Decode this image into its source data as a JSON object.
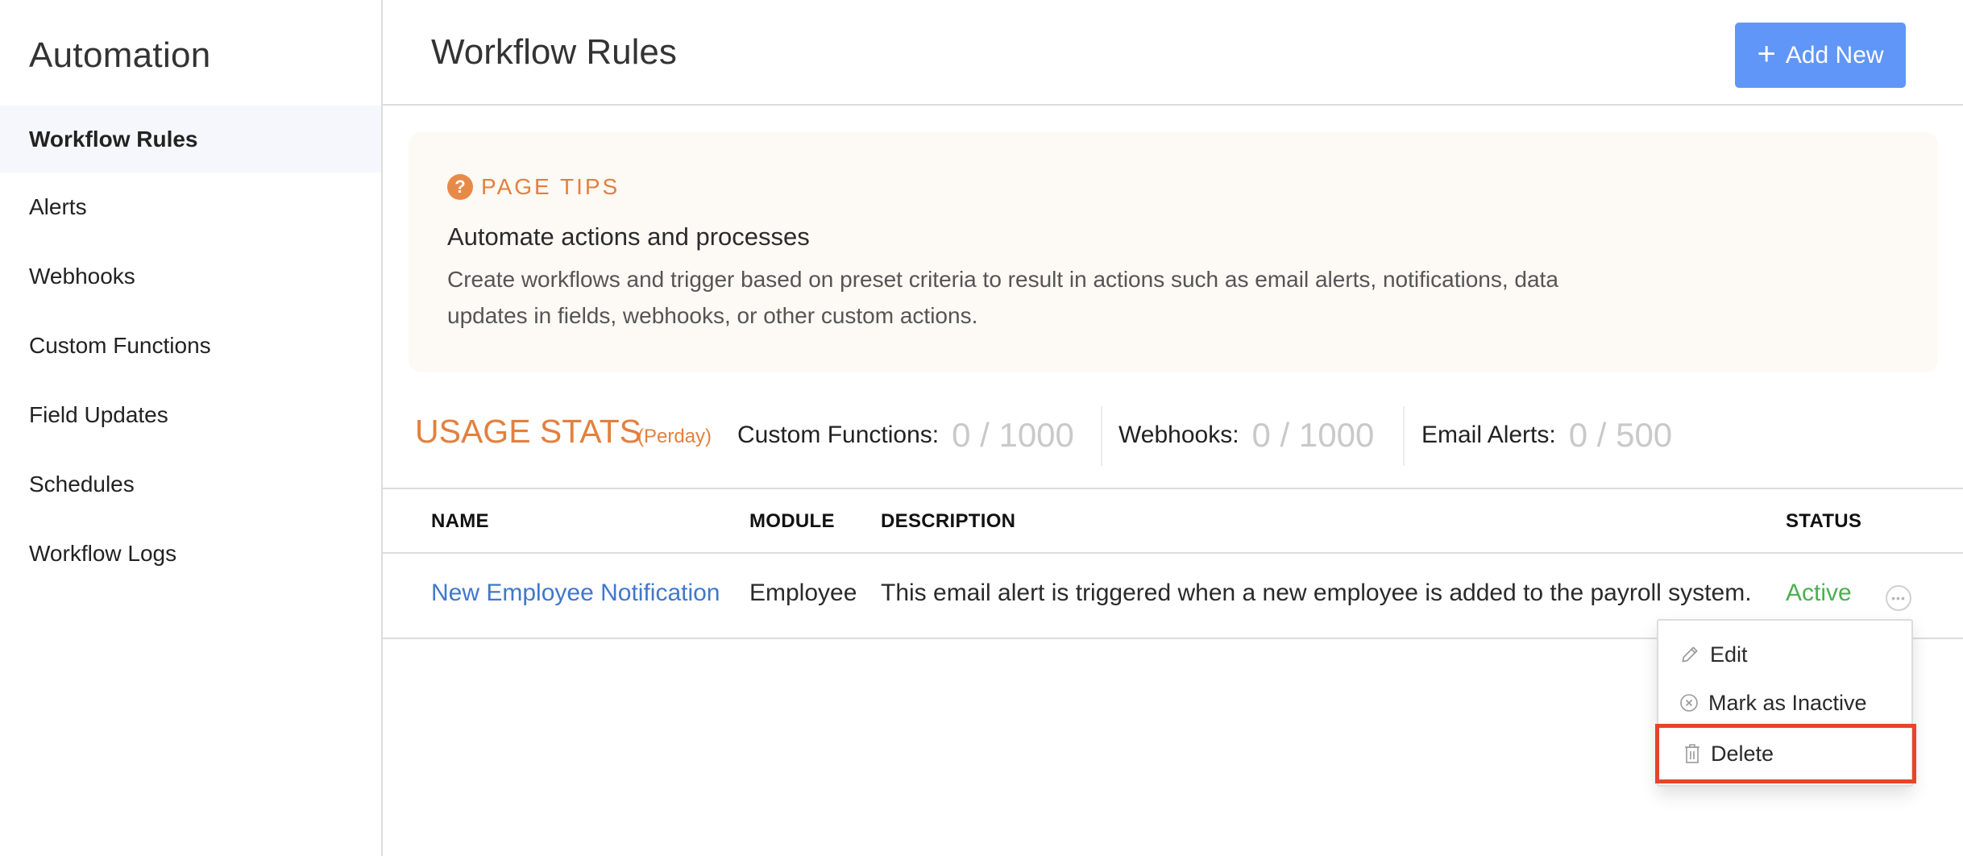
{
  "sidebar": {
    "title": "Automation",
    "items": [
      {
        "label": "Workflow Rules",
        "active": true
      },
      {
        "label": "Alerts"
      },
      {
        "label": "Webhooks"
      },
      {
        "label": "Custom Functions"
      },
      {
        "label": "Field Updates"
      },
      {
        "label": "Schedules"
      },
      {
        "label": "Workflow Logs"
      }
    ]
  },
  "header": {
    "title": "Workflow Rules",
    "add_new_label": "Add New",
    "add_new_icon": "plus-icon"
  },
  "page_tips": {
    "icon": "question-circle-icon",
    "label": "PAGE TIPS",
    "title": "Automate actions and processes",
    "description": "Create workflows and trigger based on preset criteria to result in actions such as email alerts, notifications, data updates in fields, webhooks, or other custom actions."
  },
  "usage_stats": {
    "title": "USAGE STATS",
    "period": "(Perday)",
    "stats": [
      {
        "label": "Custom Functions:",
        "value": "0 / 1000"
      },
      {
        "label": "Webhooks:",
        "value": "0 / 1000"
      },
      {
        "label": "Email Alerts:",
        "value": "0 / 500"
      }
    ]
  },
  "table": {
    "columns": [
      "NAME",
      "MODULE",
      "DESCRIPTION",
      "STATUS"
    ],
    "rows": [
      {
        "name": "New Employee Notification",
        "module": "Employee",
        "description": "This email alert is triggered when a new employee is added to the payroll system.",
        "status": "Active"
      }
    ]
  },
  "row_menu": {
    "items": [
      {
        "label": "Edit",
        "icon": "pencil-icon"
      },
      {
        "label": "Mark as Inactive",
        "icon": "x-circle-icon"
      },
      {
        "label": "Delete",
        "icon": "trash-icon",
        "highlighted": true
      }
    ]
  },
  "colors": {
    "accent_button": "#6096f8",
    "tips_orange": "#e3803e",
    "link_blue": "#3f78cc",
    "status_green": "#4caf50",
    "highlight_red": "#e8442a"
  }
}
